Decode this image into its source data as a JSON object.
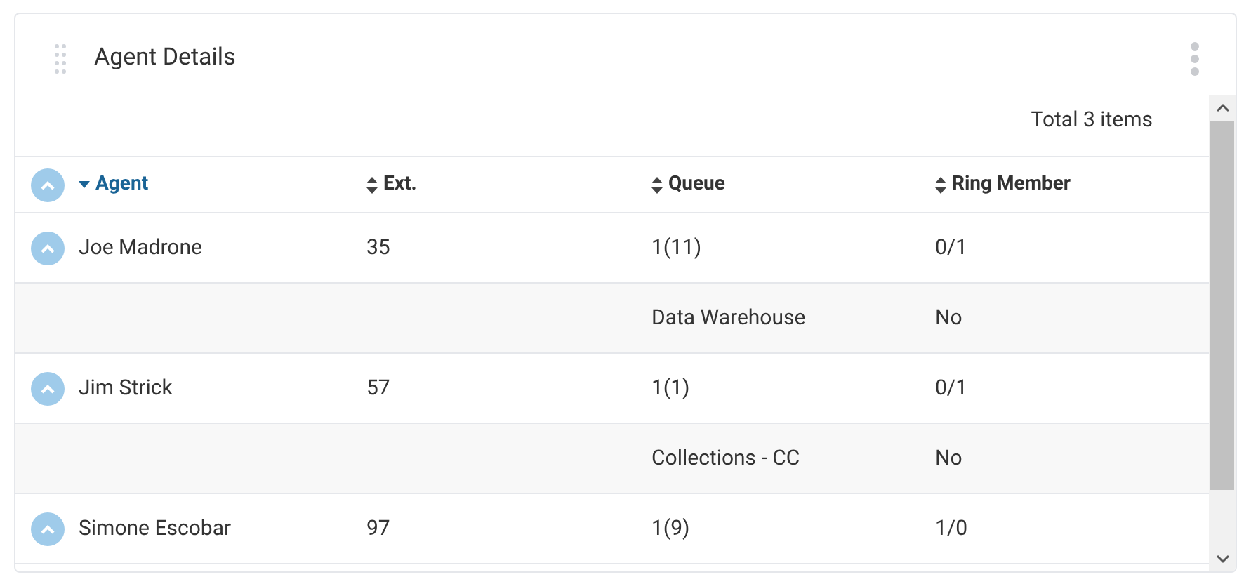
{
  "panel": {
    "title": "Agent Details"
  },
  "total": "Total 3 items",
  "columns": [
    {
      "label": "Agent",
      "sorted": true
    },
    {
      "label": "Ext.",
      "sorted": false
    },
    {
      "label": "Queue",
      "sorted": false
    },
    {
      "label": "Ring Member",
      "sorted": false
    }
  ],
  "header_expanded": true,
  "agents": [
    {
      "agent": "Joe Madrone",
      "ext": "35",
      "queue": "1(11)",
      "ring_member": "0/1",
      "expanded": true,
      "details": [
        {
          "queue": "Data Warehouse",
          "ring_member": "No"
        }
      ]
    },
    {
      "agent": "Jim Strick",
      "ext": "57",
      "queue": "1(1)",
      "ring_member": "0/1",
      "expanded": true,
      "details": [
        {
          "queue": "Collections - CC",
          "ring_member": "No"
        }
      ]
    },
    {
      "agent": "Simone Escobar",
      "ext": "97",
      "queue": "1(9)",
      "ring_member": "1/0",
      "expanded": true
    }
  ]
}
